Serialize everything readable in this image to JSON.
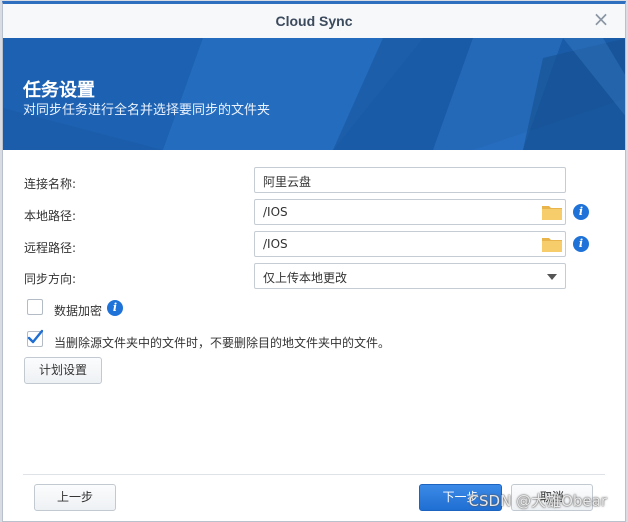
{
  "window": {
    "title": "Cloud Sync"
  },
  "banner": {
    "title": "任务设置",
    "subtitle": "对同步任务进行全名并选择要同步的文件夹"
  },
  "form": {
    "connection_name": {
      "label": "连接名称:",
      "value": "阿里云盘"
    },
    "local_path": {
      "label": "本地路径:",
      "value": "/IOS"
    },
    "remote_path": {
      "label": "远程路径:",
      "value": "/IOS"
    },
    "sync_direction": {
      "label": "同步方向:",
      "value": "仅上传本地更改"
    }
  },
  "options": {
    "encrypt": {
      "label": "数据加密",
      "checked": false
    },
    "no_delete": {
      "label": "当删除源文件夹中的文件时，不要删除目的地文件夹中的文件。",
      "checked": true
    }
  },
  "buttons": {
    "schedule": "计划设置",
    "prev": "上一步",
    "next": "下一步",
    "cancel": "取消"
  },
  "watermark": "CSDN @大雄Obear",
  "icons": {
    "close": "close-icon",
    "folder": "folder-icon",
    "info": "info-icon",
    "checkmark": "checkmark-icon",
    "dropdown": "chevron-down-icon"
  },
  "colors": {
    "accent": "#1f6ed2",
    "banner": "#1f64b4",
    "folder": "#f3c35a"
  }
}
